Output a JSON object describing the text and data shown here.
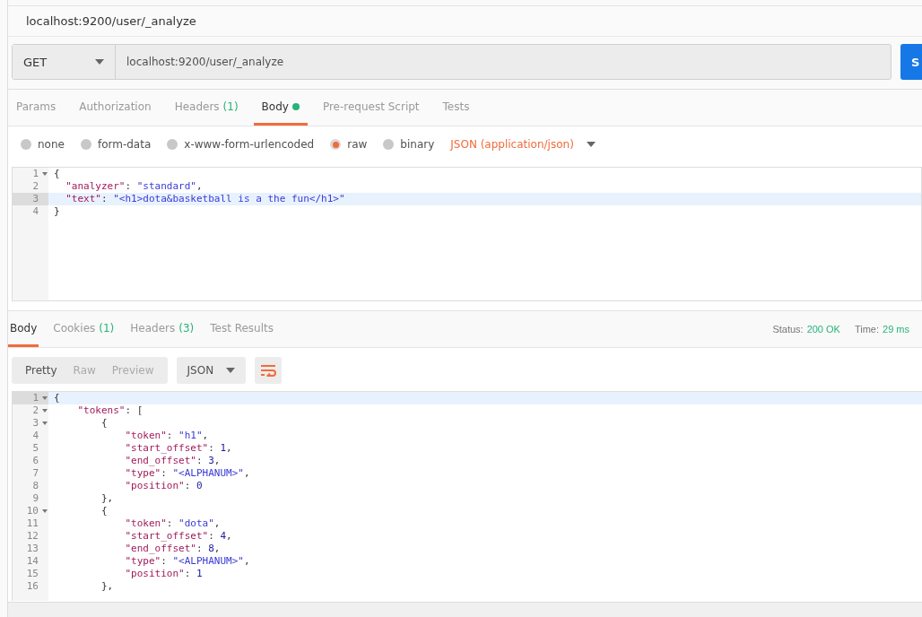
{
  "title": "localhost:9200/user/_analyze",
  "request": {
    "method": "GET",
    "url": "localhost:9200/user/_analyze",
    "send_label": "S"
  },
  "request_tabs": [
    {
      "label": "Params",
      "selected": false
    },
    {
      "label": "Authorization",
      "selected": false
    },
    {
      "label": "Headers",
      "count": "(1)",
      "selected": false
    },
    {
      "label": "Body",
      "dot": true,
      "selected": true
    },
    {
      "label": "Pre-request Script",
      "selected": false
    },
    {
      "label": "Tests",
      "selected": false
    }
  ],
  "body_types": [
    {
      "label": "none",
      "selected": false
    },
    {
      "label": "form-data",
      "selected": false
    },
    {
      "label": "x-www-form-urlencoded",
      "selected": false
    },
    {
      "label": "raw",
      "selected": true
    },
    {
      "label": "binary",
      "selected": false
    }
  ],
  "content_type": "JSON (application/json)",
  "request_editor": {
    "lines": [
      {
        "number": "1",
        "foldable": true,
        "highlighted": false,
        "segments": [
          {
            "kind": "punct",
            "text": "{"
          }
        ]
      },
      {
        "number": "2",
        "foldable": false,
        "highlighted": false,
        "segments": [
          {
            "kind": "key",
            "text": "  \"analyzer\""
          },
          {
            "kind": "punct",
            "text": ": "
          },
          {
            "kind": "string",
            "text": "\"standard\""
          },
          {
            "kind": "punct",
            "text": ","
          }
        ]
      },
      {
        "number": "3",
        "foldable": false,
        "highlighted": true,
        "segments": [
          {
            "kind": "key",
            "text": "  \"text\""
          },
          {
            "kind": "punct",
            "text": ": "
          },
          {
            "kind": "string",
            "text": "\"<h1>dota&basketball is a the fun</h1>\""
          }
        ]
      },
      {
        "number": "4",
        "foldable": false,
        "highlighted": false,
        "segments": [
          {
            "kind": "punct",
            "text": "}"
          }
        ]
      }
    ]
  },
  "response_tabs": [
    {
      "label": "Body",
      "selected": true
    },
    {
      "label": "Cookies",
      "count": "(1)",
      "selected": false
    },
    {
      "label": "Headers",
      "count": "(3)",
      "selected": false
    },
    {
      "label": "Test Results",
      "selected": false
    }
  ],
  "status": {
    "label": "Status:",
    "value": "200 OK"
  },
  "time": {
    "label": "Time:",
    "value": "29 ms"
  },
  "view_modes": [
    {
      "label": "Pretty",
      "selected": true
    },
    {
      "label": "Raw",
      "selected": false
    },
    {
      "label": "Preview",
      "selected": false
    }
  ],
  "format": "JSON",
  "response_editor": {
    "lines": [
      {
        "number": "1",
        "foldable": true,
        "highlighted": true,
        "segments": [
          {
            "kind": "punct",
            "text": "{"
          }
        ]
      },
      {
        "number": "2",
        "foldable": true,
        "highlighted": false,
        "segments": [
          {
            "kind": "key",
            "text": "    \"tokens\""
          },
          {
            "kind": "punct",
            "text": ": ["
          }
        ]
      },
      {
        "number": "3",
        "foldable": true,
        "highlighted": false,
        "segments": [
          {
            "kind": "punct",
            "text": "        {"
          }
        ]
      },
      {
        "number": "4",
        "foldable": false,
        "highlighted": false,
        "segments": [
          {
            "kind": "key",
            "text": "            \"token\""
          },
          {
            "kind": "punct",
            "text": ": "
          },
          {
            "kind": "string",
            "text": "\"h1\""
          },
          {
            "kind": "punct",
            "text": ","
          }
        ]
      },
      {
        "number": "5",
        "foldable": false,
        "highlighted": false,
        "segments": [
          {
            "kind": "key",
            "text": "            \"start_offset\""
          },
          {
            "kind": "punct",
            "text": ": "
          },
          {
            "kind": "number",
            "text": "1"
          },
          {
            "kind": "punct",
            "text": ","
          }
        ]
      },
      {
        "number": "6",
        "foldable": false,
        "highlighted": false,
        "segments": [
          {
            "kind": "key",
            "text": "            \"end_offset\""
          },
          {
            "kind": "punct",
            "text": ": "
          },
          {
            "kind": "number",
            "text": "3"
          },
          {
            "kind": "punct",
            "text": ","
          }
        ]
      },
      {
        "number": "7",
        "foldable": false,
        "highlighted": false,
        "segments": [
          {
            "kind": "key",
            "text": "            \"type\""
          },
          {
            "kind": "punct",
            "text": ": "
          },
          {
            "kind": "string",
            "text": "\"<ALPHANUM>\""
          },
          {
            "kind": "punct",
            "text": ","
          }
        ]
      },
      {
        "number": "8",
        "foldable": false,
        "highlighted": false,
        "segments": [
          {
            "kind": "key",
            "text": "            \"position\""
          },
          {
            "kind": "punct",
            "text": ": "
          },
          {
            "kind": "number",
            "text": "0"
          }
        ]
      },
      {
        "number": "9",
        "foldable": false,
        "highlighted": false,
        "segments": [
          {
            "kind": "punct",
            "text": "        },"
          }
        ]
      },
      {
        "number": "10",
        "foldable": true,
        "highlighted": false,
        "segments": [
          {
            "kind": "punct",
            "text": "        {"
          }
        ]
      },
      {
        "number": "11",
        "foldable": false,
        "highlighted": false,
        "segments": [
          {
            "kind": "key",
            "text": "            \"token\""
          },
          {
            "kind": "punct",
            "text": ": "
          },
          {
            "kind": "string",
            "text": "\"dota\""
          },
          {
            "kind": "punct",
            "text": ","
          }
        ]
      },
      {
        "number": "12",
        "foldable": false,
        "highlighted": false,
        "segments": [
          {
            "kind": "key",
            "text": "            \"start_offset\""
          },
          {
            "kind": "punct",
            "text": ": "
          },
          {
            "kind": "number",
            "text": "4"
          },
          {
            "kind": "punct",
            "text": ","
          }
        ]
      },
      {
        "number": "13",
        "foldable": false,
        "highlighted": false,
        "segments": [
          {
            "kind": "key",
            "text": "            \"end_offset\""
          },
          {
            "kind": "punct",
            "text": ": "
          },
          {
            "kind": "number",
            "text": "8"
          },
          {
            "kind": "punct",
            "text": ","
          }
        ]
      },
      {
        "number": "14",
        "foldable": false,
        "highlighted": false,
        "segments": [
          {
            "kind": "key",
            "text": "            \"type\""
          },
          {
            "kind": "punct",
            "text": ": "
          },
          {
            "kind": "string",
            "text": "\"<ALPHANUM>\""
          },
          {
            "kind": "punct",
            "text": ","
          }
        ]
      },
      {
        "number": "15",
        "foldable": false,
        "highlighted": false,
        "segments": [
          {
            "kind": "key",
            "text": "            \"position\""
          },
          {
            "kind": "punct",
            "text": ": "
          },
          {
            "kind": "number",
            "text": "1"
          }
        ]
      },
      {
        "number": "16",
        "foldable": false,
        "highlighted": false,
        "segments": [
          {
            "kind": "punct",
            "text": "        },"
          }
        ]
      }
    ]
  }
}
